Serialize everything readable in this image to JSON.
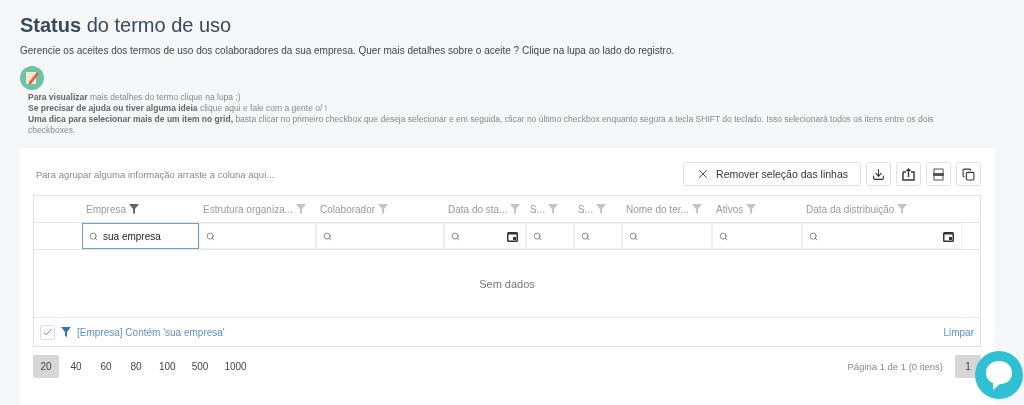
{
  "header": {
    "title": "**Status** do termo de uso",
    "description": "Gerencie os aceites dos termos de uso dos colaboradores da sua empresa. Quer mais detalhes sobre o aceite ? Clique na lupa ao lado do registro."
  },
  "tips": [
    "**Para visualizar** mais detalhes do termo clique na lupa ;)",
    "**Se precisar de ajuda ou tiver alguma ideia** clique aqui e fale com a gente o/ !",
    "**Uma dica para selecionar mais de um item no grid,** basta clicar no primeiro checkbox que deseja selecionar e em seguida, clicar no último checkbox enquanto segura a tecla SHIFT do teclado. Isso selecionará todos os itens entre os dois checkboxes."
  ],
  "grid": {
    "group_panel": "Para agrupar alguma informação arraste a coluna aqui...",
    "clear_selection_button": "Remover seleção das linhas",
    "columns": [
      {
        "label": "Empresa",
        "filter_active": true,
        "filter": {
          "kind": "text",
          "value": "sua empresa",
          "focused": true
        }
      },
      {
        "label": "Estrutura organiza...",
        "filter_active": false,
        "filter": {
          "kind": "text",
          "focused": false
        }
      },
      {
        "label": "Colaborador",
        "filter_active": false,
        "filter": {
          "kind": "text",
          "focused": false
        }
      },
      {
        "label": "Data do sta...",
        "filter_active": false,
        "filter": {
          "kind": "date",
          "focused": false
        }
      },
      {
        "label": "S...",
        "filter_active": false,
        "filter": {
          "kind": "text",
          "focused": false
        }
      },
      {
        "label": "S...",
        "filter_active": false,
        "filter": {
          "kind": "text",
          "focused": false
        }
      },
      {
        "label": "Nome do ter...",
        "filter_active": false,
        "filter": {
          "kind": "text",
          "focused": false
        }
      },
      {
        "label": "Ativos",
        "filter_active": false,
        "filter": {
          "kind": "text",
          "focused": false
        }
      },
      {
        "label": "Data da distribuição",
        "filter_active": false,
        "filter": {
          "kind": "date",
          "focused": false
        }
      }
    ],
    "empty_text": "Sem dados",
    "filter_panel": {
      "enabled": true,
      "text": "[Empresa] Contém 'sua empresa'",
      "clear": "Limpar"
    },
    "page_sizes": [
      {
        "label": "20",
        "selected": true
      },
      {
        "label": "40",
        "selected": false
      },
      {
        "label": "60",
        "selected": false
      },
      {
        "label": "80",
        "selected": false
      },
      {
        "label": "100",
        "selected": false
      },
      {
        "label": "500",
        "selected": false
      },
      {
        "label": "1000",
        "selected": false
      }
    ],
    "page_info": "Página 1 de 1 (0 itens)",
    "pages": [
      {
        "label": "1",
        "selected": true
      }
    ]
  }
}
